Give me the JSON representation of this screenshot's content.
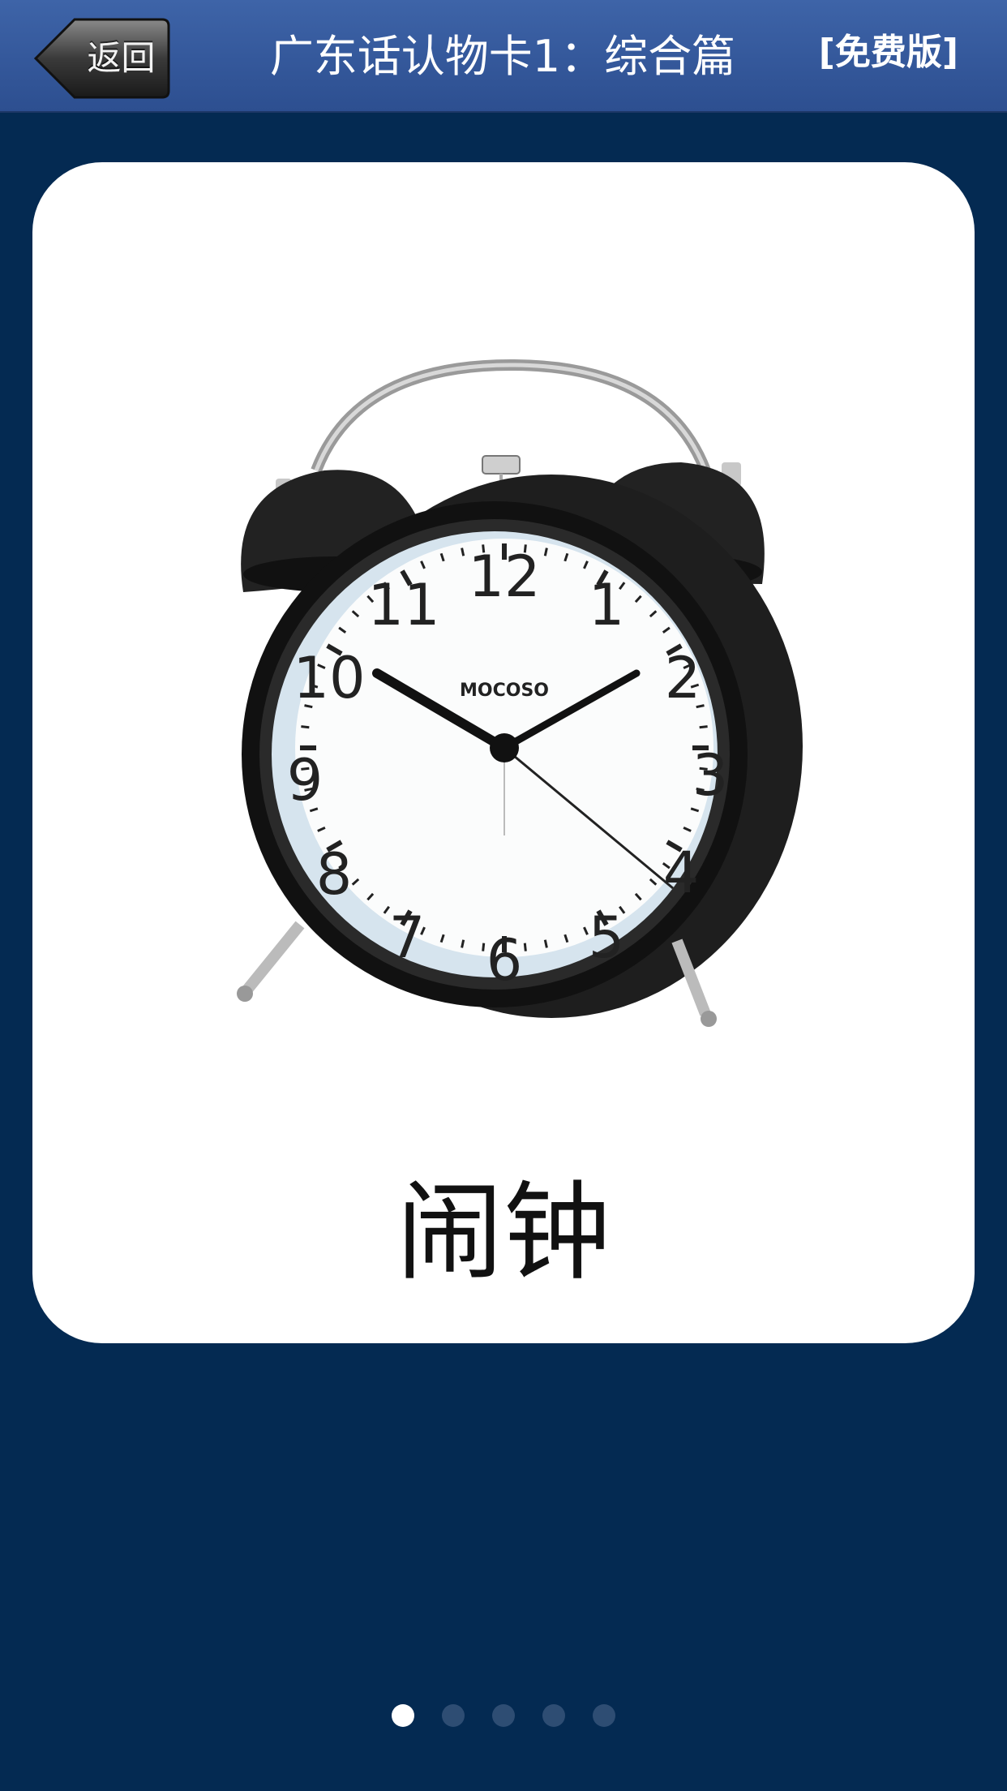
{
  "nav_bar": {
    "back_label": "返回",
    "title": "广东话认物卡1：综合篇",
    "edition_badge": "[免费版]"
  },
  "card": {
    "word": "闹钟",
    "image": {
      "icon": "alarm-clock-photo",
      "brand_text": "MOCOSO",
      "dial_numbers": [
        "12",
        "1",
        "2",
        "3",
        "4",
        "5",
        "6",
        "7",
        "8",
        "9",
        "10",
        "11"
      ]
    }
  },
  "pagination": {
    "total_pages": 5,
    "current_page": 1
  },
  "colors": {
    "background": "#042a52",
    "nav_bar": "#35599c",
    "card": "#ffffff",
    "dot_active": "#ffffff",
    "dot_inactive": "#2e4d73"
  }
}
